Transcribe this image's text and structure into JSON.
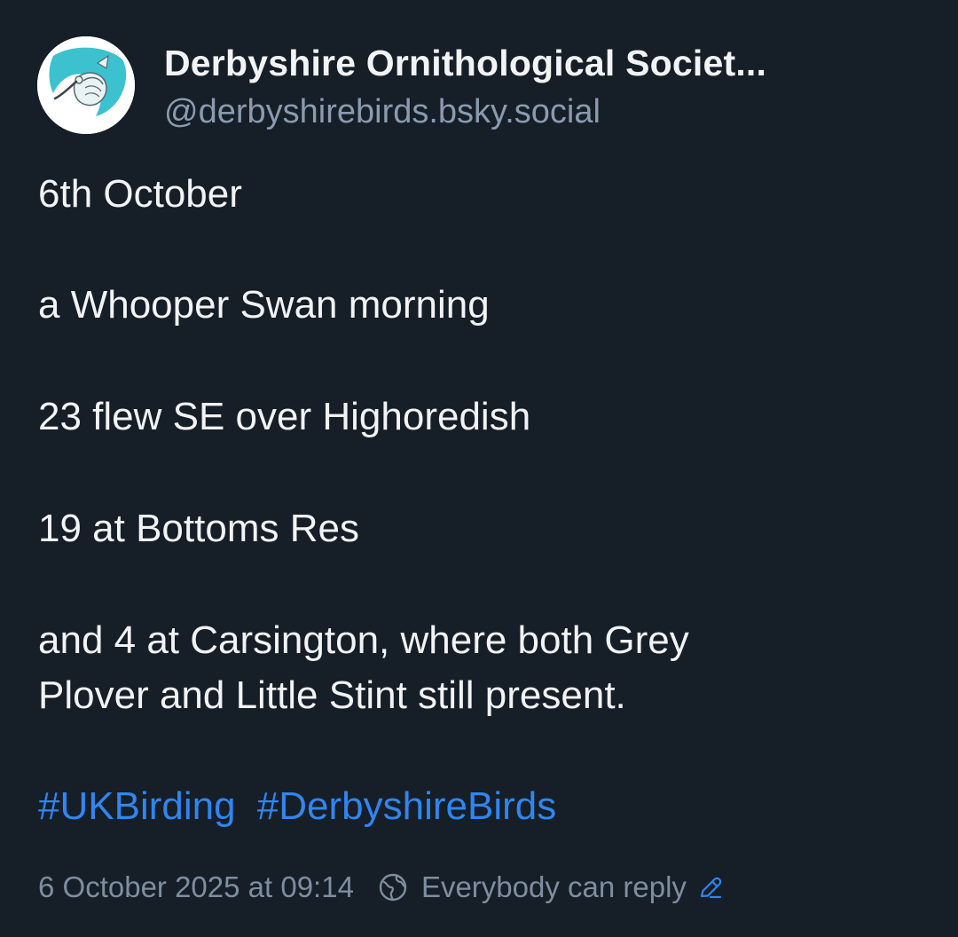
{
  "author": {
    "display_name": "Derbyshire Ornithological Societ...",
    "handle": "@derbyshirebirds.bsky.social",
    "avatar_icon": "curlew-logo-icon"
  },
  "post": {
    "lines": [
      "6th October",
      "a Whooper Swan morning",
      "23 flew SE over Highoredish",
      "19 at Bottoms Res",
      "and 4 at Carsington, where both Grey",
      "Plover and Little Stint still present."
    ],
    "hashtags": [
      "#UKBirding",
      "#DerbyshireBirds"
    ]
  },
  "meta": {
    "timestamp": "6 October 2025 at 09:14",
    "reply_setting": "Everybody can reply",
    "globe_icon": "globe-icon",
    "edit_icon": "pencil-icon"
  },
  "colors": {
    "background": "#161e27",
    "text": "#f1f3f5",
    "muted": "#8a9bb0",
    "link": "#2f86f0",
    "avatar_accent": "#3cc2cf"
  }
}
